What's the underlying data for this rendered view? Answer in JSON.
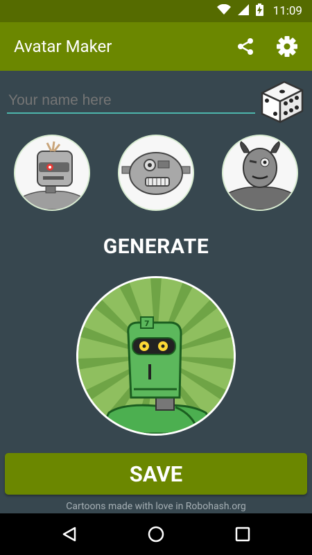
{
  "status_bar": {
    "time": "11:09",
    "icons": [
      "wifi-icon",
      "signal-icon",
      "battery-charging-icon"
    ]
  },
  "app_bar": {
    "title": "Avatar Maker",
    "actions": [
      "share-icon",
      "settings-gear-icon"
    ]
  },
  "name_input": {
    "placeholder": "Your name here",
    "value": ""
  },
  "dice_button": {
    "icon": "dice-icon"
  },
  "avatar_options": [
    {
      "name": "robot-set-1",
      "icon": "robot-avatar-icon"
    },
    {
      "name": "robot-set-2",
      "icon": "robot-head-avatar-icon"
    },
    {
      "name": "monster-set",
      "icon": "monster-avatar-icon"
    }
  ],
  "generate_label": "GENERATE",
  "save_button": {
    "label": "SAVE"
  },
  "credits": "Cartoons made with love in Robohash.org",
  "nav_bar": {
    "buttons": [
      "back-icon",
      "home-icon",
      "recents-icon"
    ]
  },
  "colors": {
    "background": "#37474f",
    "app_bar": "#6b8700",
    "status_bar": "#556b00",
    "accent": "#4db6ac",
    "save_button": "#6b8700"
  }
}
